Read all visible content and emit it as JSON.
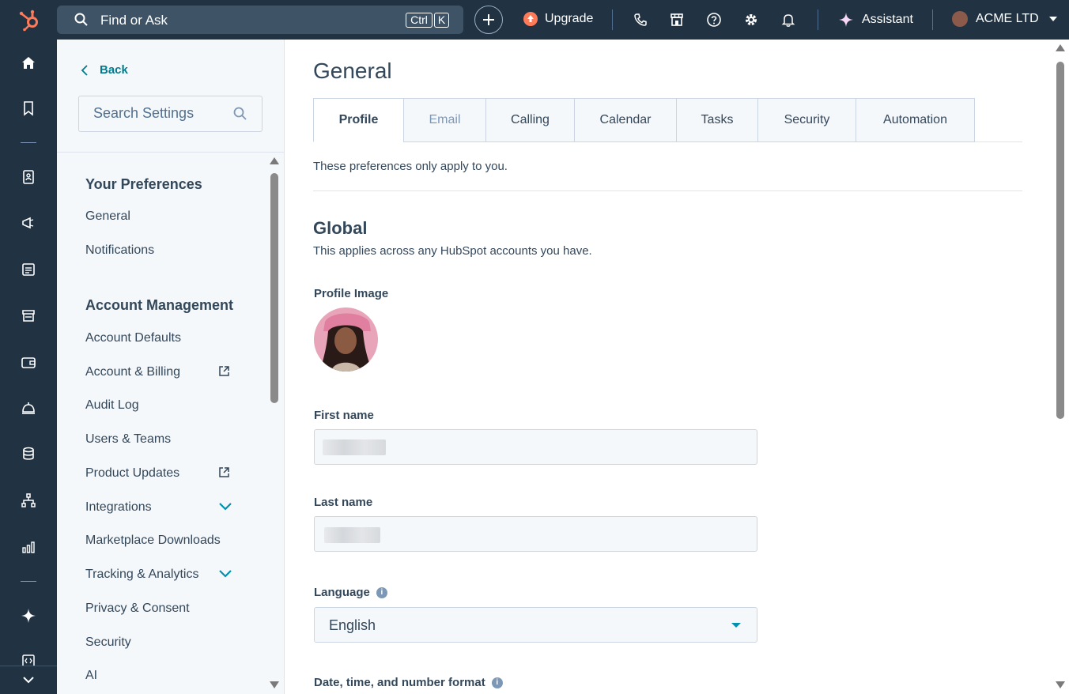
{
  "topbar": {
    "search_text": "Find or Ask",
    "kbd_ctrl": "Ctrl",
    "kbd_k": "K",
    "upgrade_label": "Upgrade",
    "assistant_label": "Assistant",
    "account_name": "ACME LTD"
  },
  "leftnav": {
    "icons": [
      "home-icon",
      "bookmark-icon",
      "contacts-icon",
      "marketing-icon",
      "content-icon",
      "commerce-icon",
      "sales-icon",
      "service-icon",
      "data-icon",
      "automation-icon",
      "reporting-icon",
      "breeze-icon",
      "development-icon",
      "collapse-icon"
    ]
  },
  "sidebar": {
    "back_label": "Back",
    "search_placeholder": "Search Settings",
    "section_preferences": "Your Preferences",
    "pref_items": [
      "General",
      "Notifications"
    ],
    "section_account": "Account Management",
    "account_items": {
      "account_defaults": "Account Defaults",
      "account_billing": "Account & Billing",
      "audit_log": "Audit Log",
      "users_teams": "Users & Teams",
      "product_updates": "Product Updates",
      "integrations": "Integrations",
      "marketplace_downloads": "Marketplace Downloads",
      "tracking_analytics": "Tracking & Analytics",
      "privacy_consent": "Privacy & Consent",
      "security": "Security",
      "ai": "AI"
    }
  },
  "main": {
    "title": "General",
    "tabs": [
      "Profile",
      "Email",
      "Calling",
      "Calendar",
      "Tasks",
      "Security",
      "Automation"
    ],
    "active_tab": "Profile",
    "preferences_note": "These preferences only apply to you.",
    "global_heading": "Global",
    "global_sub": "This applies across any HubSpot accounts you have.",
    "profile_image_label": "Profile Image",
    "first_name_label": "First name",
    "last_name_label": "Last name",
    "language_label": "Language",
    "language_value": "English",
    "datetime_label": "Date, time, and number format"
  },
  "colors": {
    "topbar_bg": "#213343",
    "accent_teal": "#007a8c",
    "upgrade_orange": "#ff7a59",
    "text_dark": "#33475b"
  }
}
